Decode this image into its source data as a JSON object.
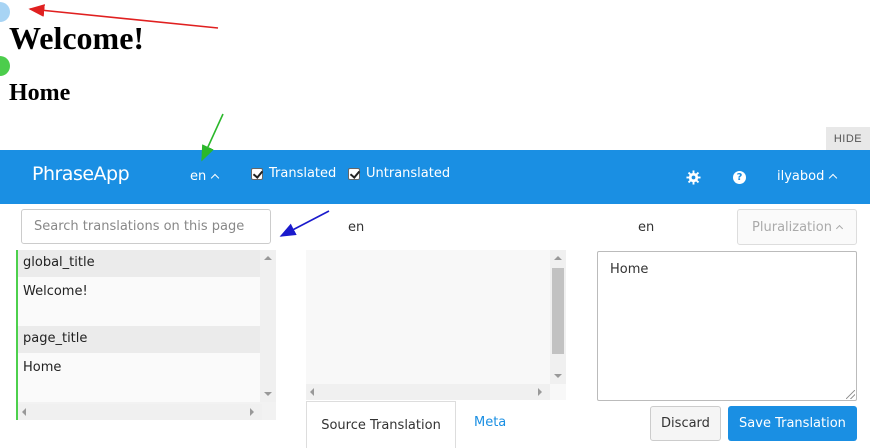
{
  "page": {
    "heading": "Welcome!",
    "subheading": "Home"
  },
  "hide_label": "HIDE",
  "header": {
    "brand": "PhraseApp",
    "locale": "en",
    "filters": [
      {
        "label": "Translated",
        "checked": true
      },
      {
        "label": "Untranslated",
        "checked": true
      }
    ],
    "icons": [
      "gear-icon",
      "help-icon"
    ],
    "help_glyph": "?",
    "user": "ilyabod"
  },
  "search": {
    "placeholder": "Search translations on this page",
    "value": ""
  },
  "keys": [
    {
      "key": "global_title",
      "value": "Welcome!"
    },
    {
      "key": "page_title",
      "value": "Home"
    }
  ],
  "source": {
    "locale": "en",
    "tabs": [
      "Source Translation",
      "Meta"
    ]
  },
  "target": {
    "locale": "en",
    "pluralization": "Pluralization",
    "text": "Home"
  },
  "actions": {
    "discard": "Discard",
    "save": "Save Translation"
  },
  "colors": {
    "brand_blue": "#1a8fe3",
    "active_key_border": "#4cd04c",
    "annotation_red": "#e02020",
    "annotation_green": "#2bb82b",
    "annotation_blue": "#1a1acc"
  }
}
